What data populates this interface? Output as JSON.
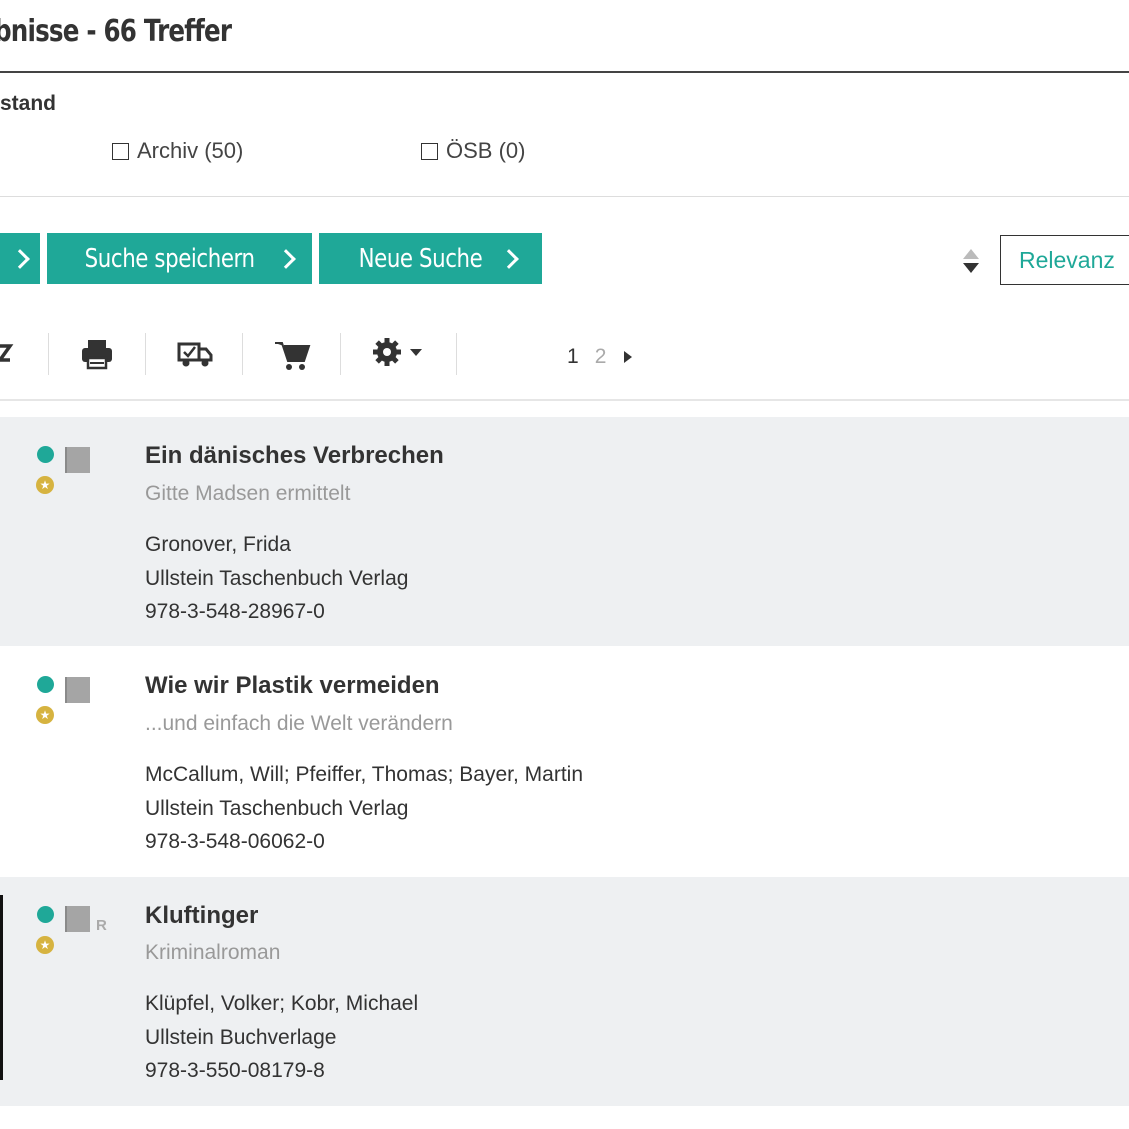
{
  "header": {
    "title": "bnisse - 66 Treffer"
  },
  "facet": {
    "label": "stand",
    "options": [
      {
        "label": "Archiv (50)"
      },
      {
        "label": "ÖSB (0)"
      }
    ]
  },
  "actions": {
    "save_search": "Suche speichern",
    "new_search": "Neue Suche",
    "sort_value": "Relevanz"
  },
  "toolbar": {
    "icons": [
      "export-icon",
      "print-icon",
      "delivery-truck-icon",
      "cart-icon",
      "settings-gear-icon"
    ],
    "pagination": {
      "current": "1",
      "next": "2"
    }
  },
  "results": [
    {
      "title": "Ein dänisches Verbrechen",
      "subtitle": "Gitte Madsen ermittelt",
      "author": "Gronover, Frida",
      "publisher": "Ullstein Taschenbuch Verlag",
      "isbn": "978-3-548-28967-0",
      "badge": ""
    },
    {
      "title": "Wie wir Plastik vermeiden",
      "subtitle": "...und einfach die Welt verändern",
      "author": "McCallum, Will; Pfeiffer, Thomas; Bayer, Martin",
      "publisher": "Ullstein Taschenbuch Verlag",
      "isbn": "978-3-548-06062-0",
      "badge": ""
    },
    {
      "title": "Kluftinger",
      "subtitle": "Kriminalroman",
      "author": "Klüpfel, Volker; Kobr, Michael",
      "publisher": "Ullstein Buchverlage",
      "isbn": "978-3-550-08179-8",
      "badge": "R"
    }
  ],
  "colors": {
    "accent": "#1fa898",
    "star": "#d6b340",
    "shade": "#eef0f2"
  }
}
